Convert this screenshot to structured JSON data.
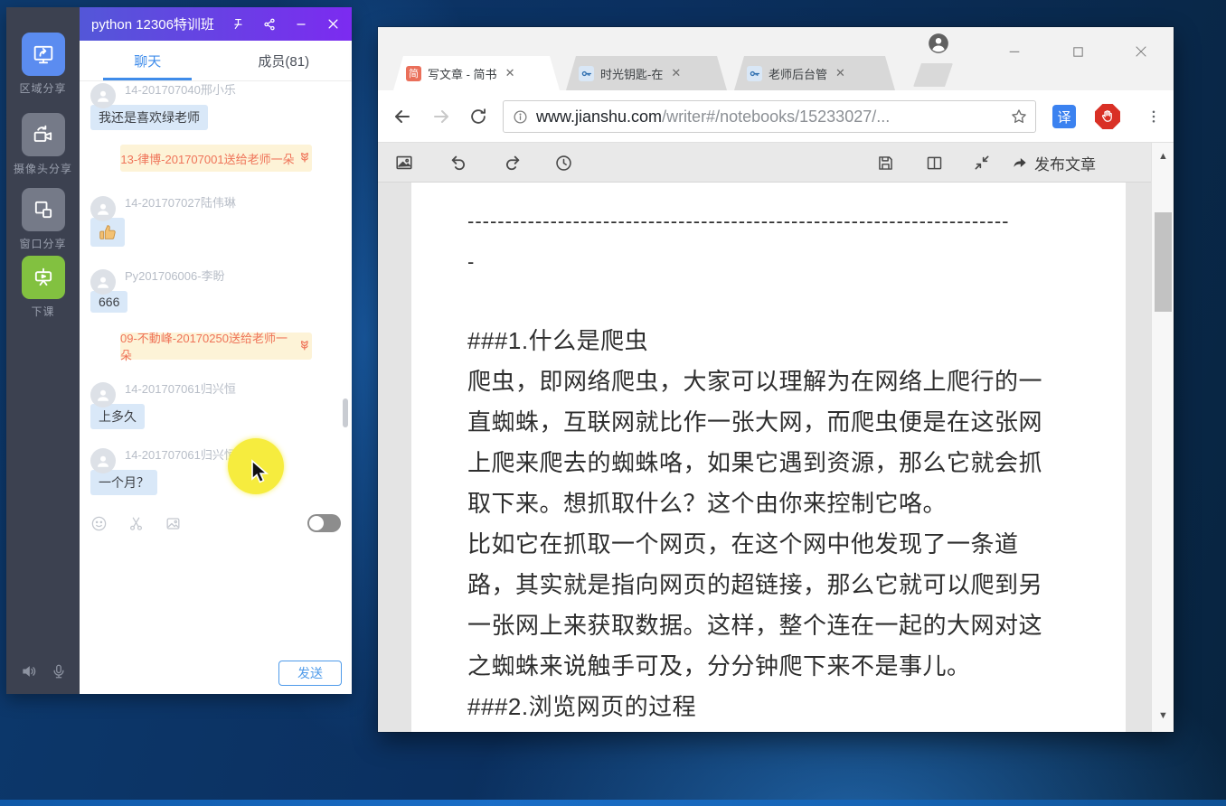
{
  "chat_app": {
    "header": {
      "title": "python 12306特训班"
    },
    "tabs": [
      {
        "label": "聊天"
      },
      {
        "label": "成员(81)"
      }
    ],
    "sidebar": {
      "items": [
        {
          "label": "区域分享",
          "icon": "screen-share-icon",
          "color": "#5b8cf0"
        },
        {
          "label": "摄像头分享",
          "icon": "camera-share-icon",
          "color": "#757a88"
        },
        {
          "label": "窗口分享",
          "icon": "window-share-icon",
          "color": "#757a88"
        },
        {
          "label": "下课",
          "icon": "class-end-icon",
          "color": "#82c140"
        }
      ]
    },
    "messages": [
      {
        "type": "user",
        "name": "14-201707040邢小乐",
        "text": "我还是喜欢绿老师"
      },
      {
        "type": "gift",
        "text": "13-律博-201707001送给老师一朵"
      },
      {
        "type": "user",
        "name": "14-201707027陆伟琳",
        "text": "",
        "emoji": "thumbs-up"
      },
      {
        "type": "user",
        "name": "Py201706006-李盼",
        "text": "666"
      },
      {
        "type": "gift",
        "text": "09-不動峰-20170250送给老师一朵"
      },
      {
        "type": "user",
        "name": "14-201707061归兴恒",
        "text": "上多久"
      },
      {
        "type": "user",
        "name": "14-201707061归兴恒",
        "text": "一个月？"
      }
    ],
    "send_label": "发送"
  },
  "browser": {
    "tabs": [
      {
        "title": "写文章 - 简书",
        "favicon": "jianshu",
        "favicon_glyph": "简",
        "active": true
      },
      {
        "title": "时光钥匙-在",
        "favicon": "key",
        "active": false
      },
      {
        "title": "老师后台管",
        "favicon": "key",
        "active": false
      }
    ],
    "url": {
      "host": "www.jianshu.com",
      "path": "/writer#/notebooks/15233027/..."
    },
    "extensions": {
      "translate_label": "译"
    },
    "editor_toolbar": {
      "publish_label": "发布文章"
    },
    "document": {
      "lines": [
        "------------------------------------------------------------------------",
        "-",
        "###1.什么是爬虫",
        "爬虫，即网络爬虫，大家可以理解为在网络上爬行的一",
        "直蜘蛛，互联网就比作一张大网，而爬虫便是在这张网",
        "上爬来爬去的蜘蛛咯，如果它遇到资源，那么它就会抓",
        "取下来。想抓取什么？这个由你来控制它咯。",
        "比如它在抓取一个网页，在这个网中他发现了一条道",
        "路，其实就是指向网页的超链接，那么它就可以爬到另",
        "一张网上来获取数据。这样，整个连在一起的大网对这",
        "之蜘蛛来说触手可及，分分钟爬下来不是事儿。",
        "###2.浏览网页的过程"
      ]
    }
  },
  "colors": {
    "chat_header_gradient": [
      "#5357d8",
      "#7c2bf0"
    ],
    "chat_accent_blue": "#3f8cea",
    "gift_bg": "#fdf3d7",
    "gift_text": "#ef7358",
    "sidebar_share_blue": "#5b8cf0",
    "sidebar_end_green": "#82c140",
    "translate_blue": "#3b82f0",
    "adblock_red": "#d93025",
    "jianshu_red": "#ea6f5a"
  }
}
